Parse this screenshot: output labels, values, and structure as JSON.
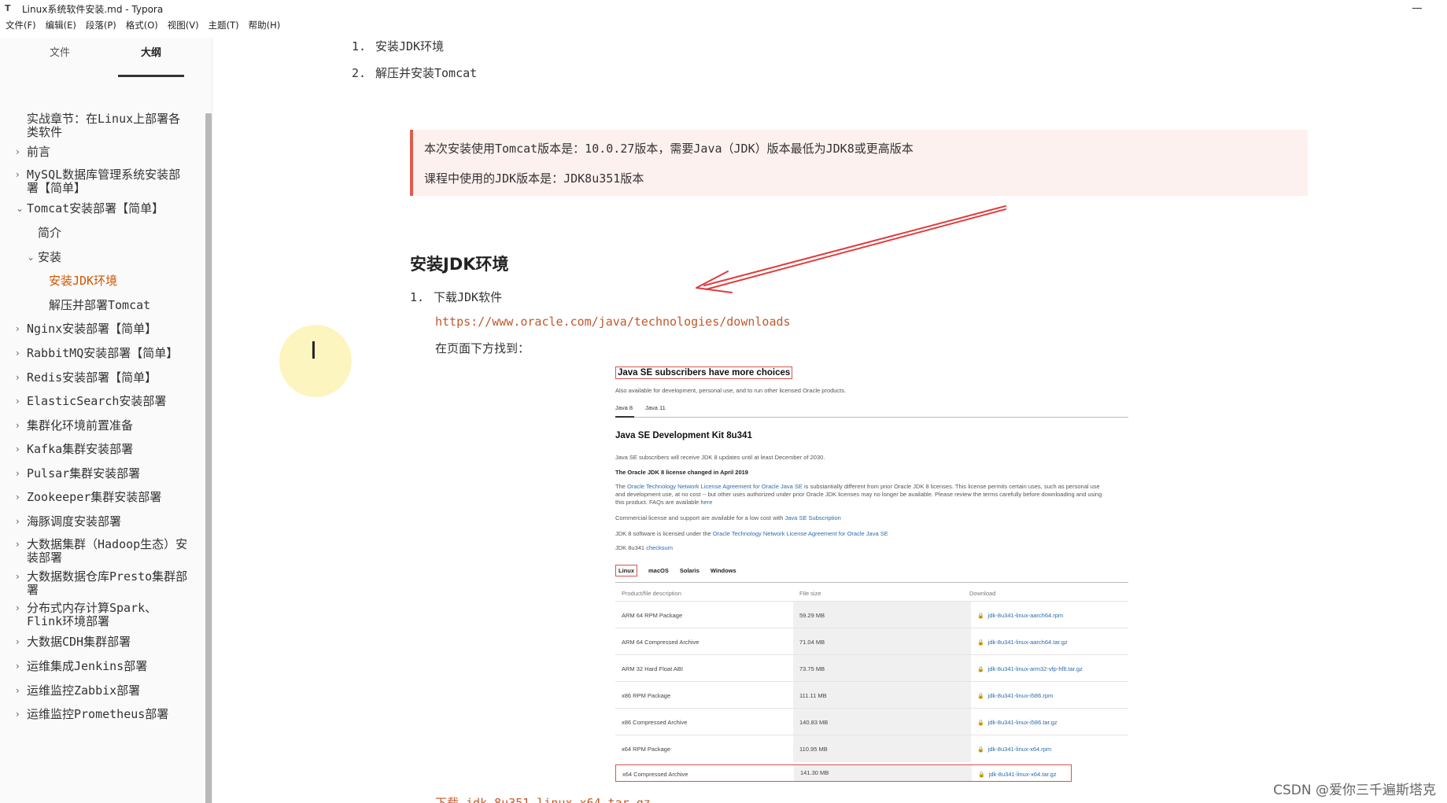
{
  "window": {
    "title": "Linux系统软件安装.md - Typora",
    "app_icon": "T"
  },
  "menu": [
    "文件(F)",
    "编辑(E)",
    "段落(P)",
    "格式(O)",
    "视图(V)",
    "主题(T)",
    "帮助(H)"
  ],
  "sidebar": {
    "tabs": {
      "file": "文件",
      "outline": "大纲"
    },
    "items": [
      {
        "label": "实战章节：在Linux上部署各类软件",
        "chevron": ""
      },
      {
        "label": "前言",
        "chevron": "›"
      },
      {
        "label": "MySQL数据库管理系统安装部署【简单】",
        "chevron": "›"
      },
      {
        "label": "Tomcat安装部署【简单】",
        "chevron": "⌄"
      },
      {
        "label": "简介",
        "chevron": ""
      },
      {
        "label": "安装",
        "chevron": "⌄"
      },
      {
        "label": "安装JDK环境",
        "chevron": ""
      },
      {
        "label": "解压并部署Tomcat",
        "chevron": ""
      },
      {
        "label": "Nginx安装部署【简单】",
        "chevron": "›"
      },
      {
        "label": "RabbitMQ安装部署【简单】",
        "chevron": "›"
      },
      {
        "label": "Redis安装部署【简单】",
        "chevron": "›"
      },
      {
        "label": "ElasticSearch安装部署",
        "chevron": "›"
      },
      {
        "label": "集群化环境前置准备",
        "chevron": "›"
      },
      {
        "label": "Kafka集群安装部署",
        "chevron": "›"
      },
      {
        "label": "Pulsar集群安装部署",
        "chevron": "›"
      },
      {
        "label": "Zookeeper集群安装部署",
        "chevron": "›"
      },
      {
        "label": "海豚调度安装部署",
        "chevron": "›"
      },
      {
        "label": "大数据集群（Hadoop生态）安装部署",
        "chevron": "›"
      },
      {
        "label": "大数据数据仓库Presto集群部署",
        "chevron": "›"
      },
      {
        "label": "分布式内存计算Spark、Flink环境部署",
        "chevron": "›"
      },
      {
        "label": "大数据CDH集群部署",
        "chevron": "›"
      },
      {
        "label": "运维集成Jenkins部署",
        "chevron": "›"
      },
      {
        "label": "运维监控Zabbix部署",
        "chevron": "›"
      },
      {
        "label": "运维监控Prometheus部署",
        "chevron": "›"
      }
    ]
  },
  "content": {
    "list_top": [
      {
        "num": "1.",
        "text": "安装JDK环境"
      },
      {
        "num": "2.",
        "text": "解压并安装Tomcat"
      }
    ],
    "callout": [
      "本次安装使用Tomcat版本是：10.0.27版本，需要Java（JDK）版本最低为JDK8或更高版本",
      "课程中使用的JDK版本是：JDK8u351版本"
    ],
    "heading": "安装JDK环境",
    "step1": {
      "num": "1.",
      "text": "下载JDK软件"
    },
    "link": "https://www.oracle.com/java/technologies/downloads",
    "para": "在页面下方找到：",
    "bottom_cut": "下载 jdk-8u351-linux-x64.tar.gz"
  },
  "oracle": {
    "heading": "Java SE subscribers have more choices",
    "sub": "Also available for development, personal use, and to run other licensed Oracle products.",
    "version_tabs": [
      "Java 8",
      "Java 11"
    ],
    "title": "Java SE Development Kit 8u341",
    "p1": "Java SE subscribers will receive JDK 8 updates until at least December of 2030.",
    "p2": "The Oracle JDK 8 license changed in April 2019",
    "p3a": "The ",
    "p3link": "Oracle Technology Network License Agreement for Oracle Java SE",
    "p3b": " is substantially different from prior Oracle JDK 8 licenses. This license permits certain uses, such as personal use",
    "p3c": "and development use, at no cost -- but other uses authorized under prior Oracle JDK licenses may no longer be available. Please review the terms carefully before downloading and using",
    "p3d": "this product. FAQs are available ",
    "p3dlink": "here",
    "p4a": "Commercial license and support are available for a low cost with ",
    "p4link": "Java SE Subscription",
    "p5a": "JDK 8 software is licensed under the ",
    "p5link": "Oracle Technology Network License Agreement for Oracle Java SE",
    "p6a": "JDK 8u341 ",
    "p6link": "checksum",
    "os_tabs": [
      "Linux",
      "macOS",
      "Solaris",
      "Windows"
    ],
    "columns": [
      "Product/file description",
      "File size",
      "Download"
    ],
    "rows": [
      {
        "desc": "ARM 64 RPM Package",
        "size": "59.29 MB",
        "file": "jdk-8u341-linux-aarch64.rpm"
      },
      {
        "desc": "ARM 64 Compressed Archive",
        "size": "71.04 MB",
        "file": "jdk-8u341-linux-aarch64.tar.gz"
      },
      {
        "desc": "ARM 32 Hard Float ABI",
        "size": "73.75 MB",
        "file": "jdk-8u341-linux-arm32-vfp-hflt.tar.gz"
      },
      {
        "desc": "x86 RPM Package",
        "size": "111.11 MB",
        "file": "jdk-8u341-linux-i586.rpm"
      },
      {
        "desc": "x86 Compressed Archive",
        "size": "140.83 MB",
        "file": "jdk-8u341-linux-i586.tar.gz"
      },
      {
        "desc": "x64 RPM Package",
        "size": "110.95 MB",
        "file": "jdk-8u341-linux-x64.rpm"
      },
      {
        "desc": "x64 Compressed Archive",
        "size": "141.30 MB",
        "file": "jdk-8u341-linux-x64.tar.gz"
      }
    ]
  },
  "watermark": "CSDN @爱你三千遍斯塔克",
  "colors": {
    "accent": "#d35400",
    "link": "#c0592b",
    "callout_border": "#e05a4f",
    "arrow": "#e03c3c"
  }
}
